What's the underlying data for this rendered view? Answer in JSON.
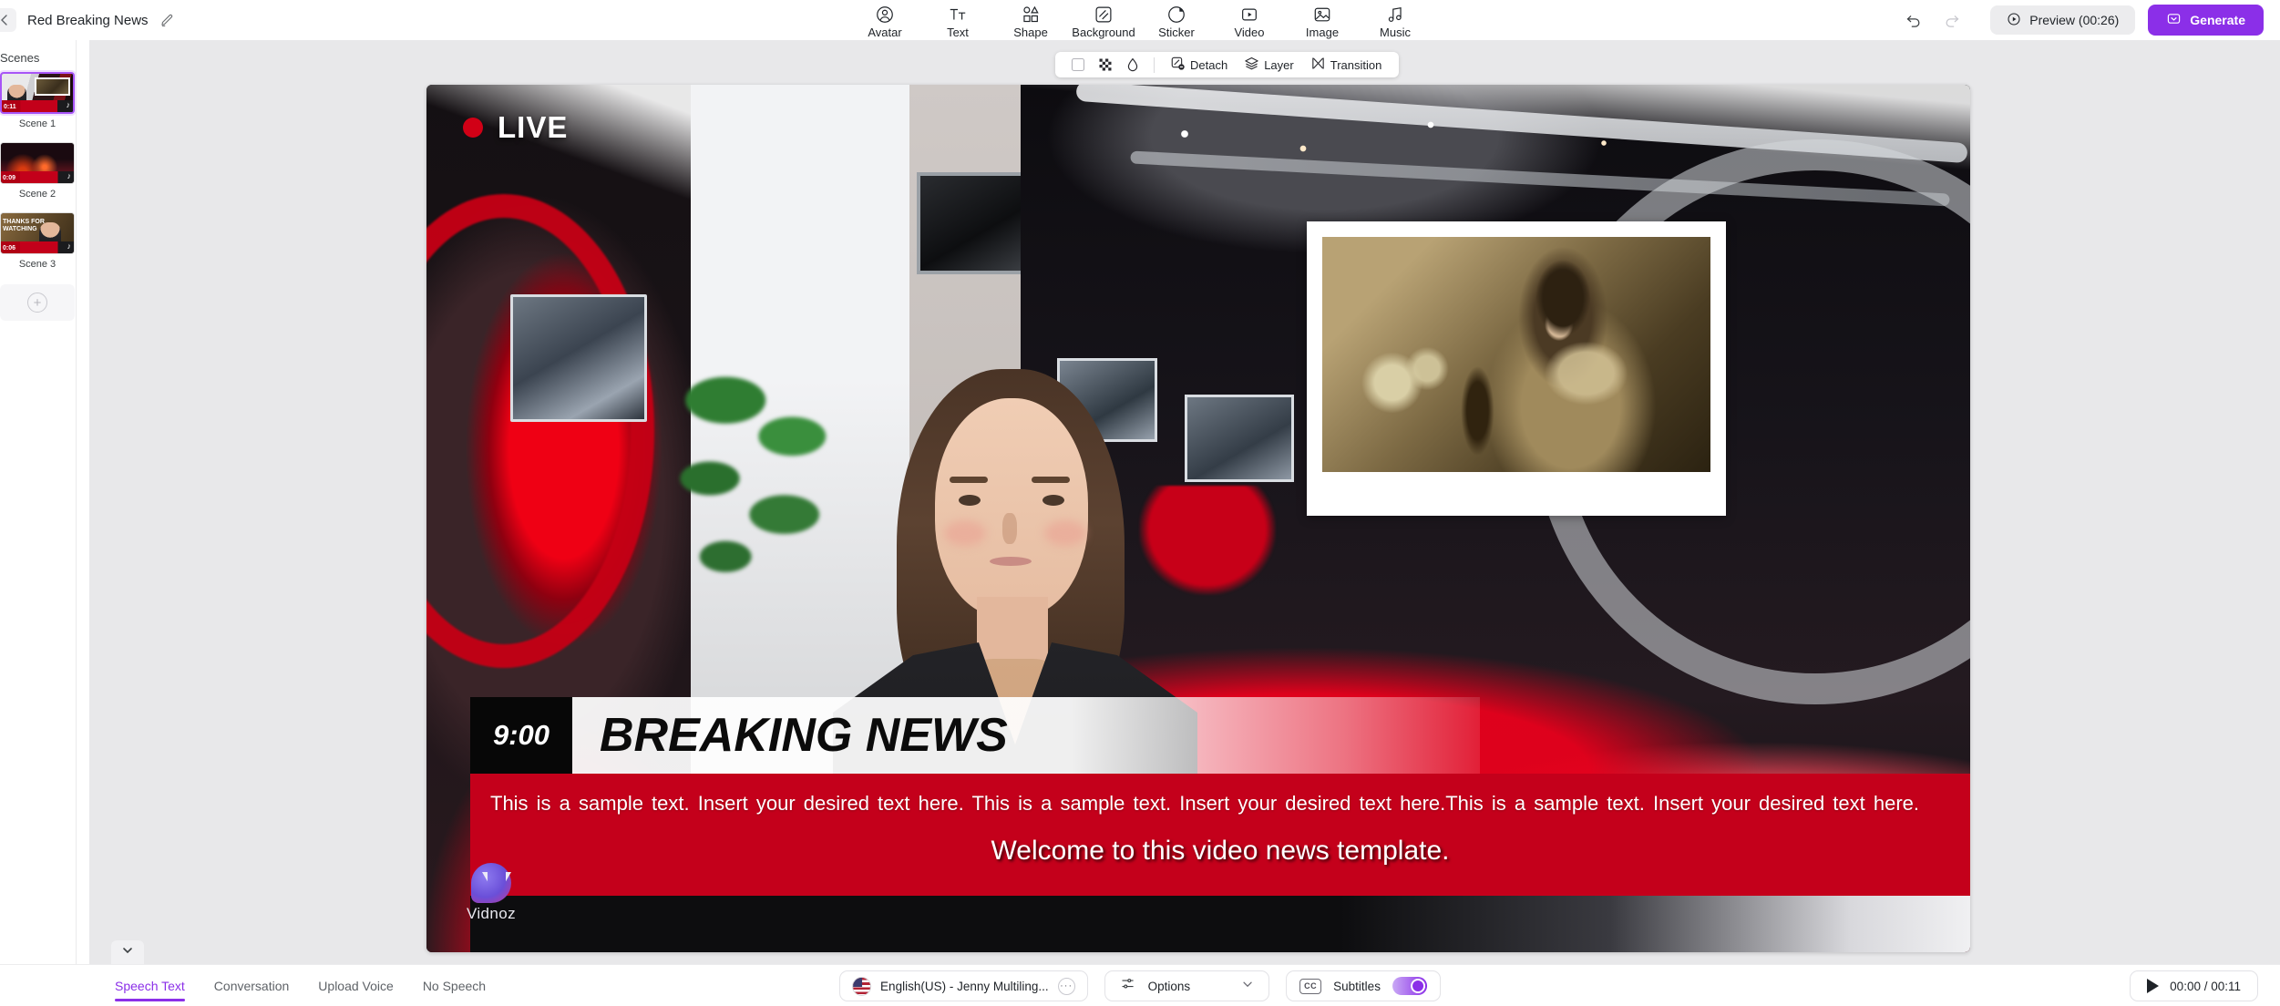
{
  "header": {
    "project_title": "Red Breaking News",
    "edit_icon": "pencil-icon",
    "back_icon": "chevron-left-icon",
    "tools": [
      {
        "label": "Avatar",
        "icon": "avatar-icon"
      },
      {
        "label": "Text",
        "icon": "text-icon"
      },
      {
        "label": "Shape",
        "icon": "shape-icon"
      },
      {
        "label": "Background",
        "icon": "background-icon"
      },
      {
        "label": "Sticker",
        "icon": "sticker-icon"
      },
      {
        "label": "Video",
        "icon": "video-icon"
      },
      {
        "label": "Image",
        "icon": "image-icon"
      },
      {
        "label": "Music",
        "icon": "music-icon"
      }
    ],
    "undo_icon": "undo-icon",
    "redo_icon": "redo-icon",
    "preview_label": "Preview (00:26)",
    "generate_label": "Generate"
  },
  "scenes_panel": {
    "title": "Scenes",
    "items": [
      {
        "caption": "Scene 1",
        "duration": "0:11",
        "selected": true
      },
      {
        "caption": "Scene 2",
        "duration": "0:09",
        "selected": false
      },
      {
        "caption": "Scene 3",
        "duration": "0:06",
        "selected": false
      }
    ],
    "add_label": "+",
    "collapse_icon": "chevron-down-icon"
  },
  "float_toolbar": {
    "items": [
      {
        "name": "color-swatch",
        "label": ""
      },
      {
        "name": "transparency-icon",
        "label": ""
      },
      {
        "name": "opacity-drop-icon",
        "label": ""
      }
    ],
    "actions": [
      {
        "label": "Detach",
        "icon": "detach-icon"
      },
      {
        "label": "Layer",
        "icon": "layer-icon"
      },
      {
        "label": "Transition",
        "icon": "transition-icon"
      }
    ]
  },
  "canvas": {
    "live_badge": "LIVE",
    "ticker_time": "9:00",
    "headline": "BREAKING NEWS",
    "sample_text": "This is a sample text. Insert your desired text here. This is a sample text. Insert your desired text here.This is a sample text. Insert your desired text here.",
    "subtitle": "Welcome to this video news template.",
    "watermark": "Vidnoz",
    "colors": {
      "band_red": "#c4001b",
      "accent_purple": "#8b2fe8",
      "live_dot": "#d10016"
    }
  },
  "bottom": {
    "tabs": [
      {
        "label": "Speech Text",
        "active": true
      },
      {
        "label": "Conversation",
        "active": false
      },
      {
        "label": "Upload Voice",
        "active": false
      },
      {
        "label": "No Speech",
        "active": false
      }
    ],
    "voice": {
      "label": "English(US) - Jenny Multiling...",
      "flag": "us-flag-icon",
      "more_icon": "more-dots-icon"
    },
    "options": {
      "label": "Options",
      "icon": "sliders-icon",
      "chevron": "chevron-down-icon"
    },
    "subtitles": {
      "label": "Subtitles",
      "icon": "cc-icon",
      "enabled": true
    },
    "player": {
      "time": "00:00 / 00:11",
      "play_icon": "play-icon"
    }
  }
}
